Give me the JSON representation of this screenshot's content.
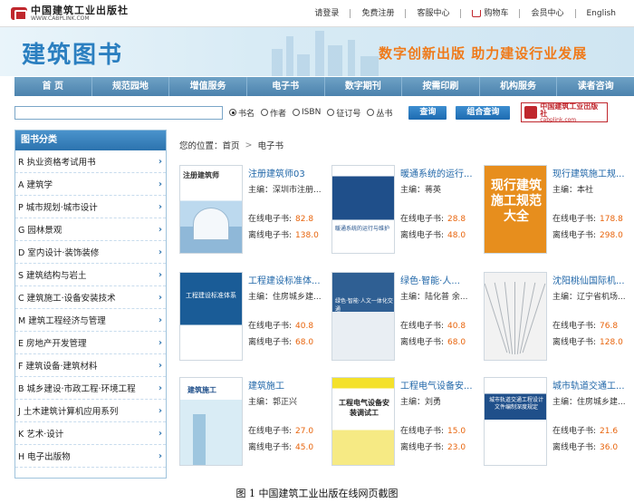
{
  "site": {
    "logo_cn": "中国建筑工业出版社",
    "logo_en": "WWW.CABPLINK.COM"
  },
  "toplinks": [
    "请登录",
    "免费注册",
    "客服中心",
    "购物车",
    "会员中心",
    "English"
  ],
  "banner": {
    "title": "建筑图书",
    "slogan": "数字创新出版  助力建设行业发展"
  },
  "nav": [
    "首 页",
    "规范园地",
    "增值服务",
    "电子书",
    "数字期刊",
    "按需印刷",
    "机构服务",
    "读者咨询"
  ],
  "search": {
    "value": "",
    "options": [
      "书名",
      "作者",
      "ISBN",
      "征订号",
      "丛书"
    ],
    "selected": "书名",
    "search_btn": "查询",
    "combo_btn": "组合查询",
    "logo_cn": "中国建筑工业出版社",
    "logo_en": "cabplink.com"
  },
  "sidebar": {
    "title": "图书分类",
    "items": [
      "R 执业资格考试用书",
      "A 建筑学",
      "P 城市规划·城市设计",
      "G 园林景观",
      "D 室内设计·装饰装修",
      "S 建筑结构与岩土",
      "C 建筑施工·设备安装技术",
      "M 建筑工程经济与管理",
      "E 房地产开发管理",
      "F 建筑设备·建筑材料",
      "B 城乡建设·市政工程·环境工程",
      "J 土木建筑计算机应用系列",
      "K 艺术·设计",
      "H 电子出版物"
    ]
  },
  "breadcrumb": {
    "label": "您的位置：",
    "home": "首页",
    "sep": ">",
    "current": "电子书"
  },
  "price_labels": {
    "online": "在线电子书:",
    "offline": "离线电子书:"
  },
  "books": [
    {
      "title": "注册建筑师03",
      "editor": "主编：深圳市注册...",
      "online": "82.8",
      "offline": "138.0",
      "cover_text": "注册建筑师"
    },
    {
      "title": "暖通系统的运行...",
      "editor": "主编：蒋英",
      "online": "28.8",
      "offline": "48.0",
      "cover_text": "暖通系统的运行与维护"
    },
    {
      "title": "现行建筑施工规...",
      "editor": "主编：本社",
      "online": "178.8",
      "offline": "298.0",
      "cover_text": "现行建筑施工规范大全"
    },
    {
      "title": "工程建设标准体...",
      "editor": "主编：住房城乡建...",
      "online": "40.8",
      "offline": "68.0",
      "cover_text": "工程建设标准体系"
    },
    {
      "title": "绿色·智能·人...",
      "editor": "主编：陆化普 余...",
      "online": "40.8",
      "offline": "68.0",
      "cover_text": "绿色·智能·人文一体化交通"
    },
    {
      "title": "沈阳桃仙国际机...",
      "editor": "主编：辽宁省机场...",
      "online": "76.8",
      "offline": "128.0",
      "cover_text": ""
    },
    {
      "title": "建筑施工",
      "editor": "主编：郭正兴",
      "online": "27.0",
      "offline": "45.0",
      "cover_text": "建筑施工"
    },
    {
      "title": "工程电气设备安...",
      "editor": "主编：刘勇",
      "online": "15.0",
      "offline": "23.0",
      "cover_text": "工程电气设备安装调试工"
    },
    {
      "title": "城市轨道交通工...",
      "editor": "主编：住房城乡建...",
      "online": "21.6",
      "offline": "36.0",
      "cover_text": "城市轨道交通工程设计文件编制深度规定"
    }
  ],
  "caption": "图 1   中国建筑工业出版在线网页截图"
}
